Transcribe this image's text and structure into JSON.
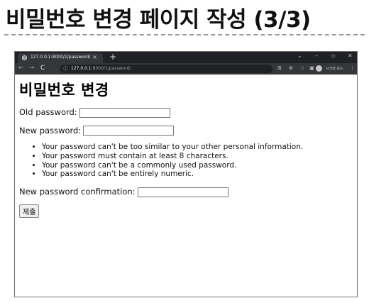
{
  "slide": {
    "title": "비밀번호 변경 페이지 작성 (3/3)"
  },
  "browser": {
    "tab_title": "127.0.0.1:8000/1/password/",
    "tab_close": "×",
    "new_tab": "+",
    "url_host": "127.0.0.1",
    "url_path": ":8000/1/password/",
    "profile_name": "시크릿 모드"
  },
  "page": {
    "heading": "비밀번호 변경",
    "old_password_label": "Old password:",
    "new_password_label": "New password:",
    "help_items": [
      "Your password can't be too similar to your other personal information.",
      "Your password must contain at least 8 characters.",
      "Your password can't be a commonly used password.",
      "Your password can't be entirely numeric."
    ],
    "confirm_label": "New password confirmation:",
    "submit_label": "제출"
  },
  "icons": [
    "globe-icon",
    "back-icon",
    "forward-icon",
    "reload-icon",
    "info-icon",
    "translate-icon",
    "zoom-icon",
    "star-icon",
    "sidepanel-icon",
    "incognito-icon",
    "menu-icon"
  ]
}
